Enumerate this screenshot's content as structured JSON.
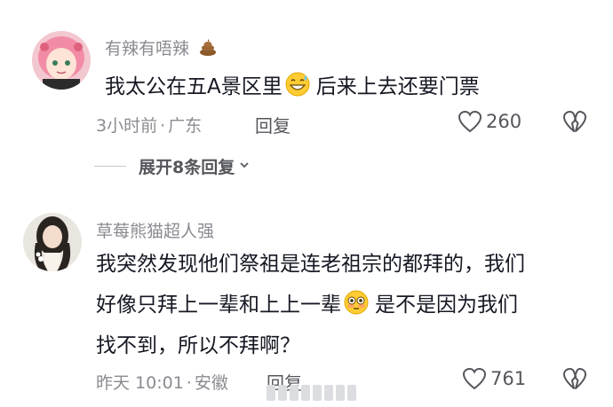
{
  "comments": [
    {
      "username": "有辣有唔辣",
      "username_emoji": "poop-emoji",
      "text_before_emoji": "我太公在五A景区里",
      "emoji": "grinning-sweat-emoji",
      "text_after_emoji": "后来上去还要门票",
      "time": "3小时前",
      "separator": "·",
      "location": "广东",
      "reply_label": "回复",
      "likes": "260",
      "expand_label": "展开8条回复"
    },
    {
      "username": "草莓熊猫超人强",
      "text_line1": "我突然发现他们祭祖是连老祖宗的都拜的，我们",
      "text_line2_before_emoji": "好像只拜上一辈和上上一辈",
      "emoji": "flushed-emoji",
      "text_line2_after_emoji": "是不是因为我们",
      "text_line3": "找不到，所以不拜啊？",
      "time": "昨天 10:01",
      "separator": "·",
      "location": "安徽",
      "reply_label": "回复",
      "likes": "761"
    }
  ],
  "colors": {
    "text": "#161823",
    "meta": "#8a8b91",
    "action": "#55565c"
  }
}
